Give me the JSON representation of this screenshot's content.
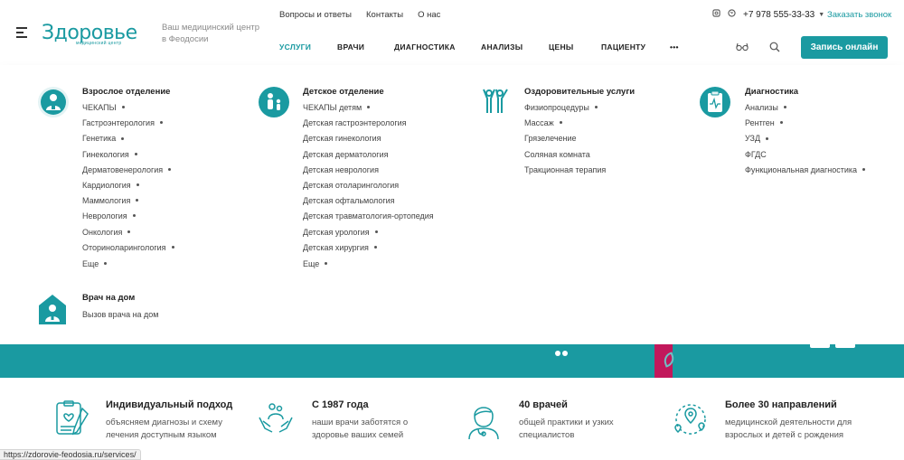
{
  "header": {
    "logo_text": "Здоровье",
    "logo_sub": "медицинский центр",
    "tagline": "Ваш медицинский центр в Феодосии",
    "top_links": [
      "Вопросы и ответы",
      "Контакты",
      "О нас"
    ],
    "phone": "+7 978 555-33-33",
    "callback": "Заказать звонок",
    "nav": [
      "УСЛУГИ",
      "ВРАЧИ",
      "ДИАГНОСТИКА",
      "АНАЛИЗЫ",
      "ЦЕНЫ",
      "ПАЦИЕНТУ",
      "•••"
    ],
    "cta": "Запись онлайн"
  },
  "menu": {
    "adult": {
      "title": "Взрослое отделение",
      "items": [
        "ЧЕКАПЫ",
        "Гастроэнтерология",
        "Генетика",
        "Гинекология",
        "Дерматовенерология",
        "Кардиология",
        "Маммология",
        "Неврология",
        "Онкология",
        "Оториноларингология",
        "Еще"
      ]
    },
    "child": {
      "title": "Детское отделение",
      "items": [
        "ЧЕКАПЫ детям",
        "Детская гастроэнтерология",
        "Детская гинекология",
        "Детская дерматология",
        "Детская неврология",
        "Детская отоларингология",
        "Детская офтальмология",
        "Детская травматология-ортопедия",
        "Детская урология",
        "Детская хирургия",
        "Еще"
      ]
    },
    "wellness": {
      "title": "Оздоровительные услуги",
      "items": [
        "Физиопроцедуры",
        "Массаж",
        "Грязелечение",
        "Соляная комната",
        "Тракционная терапия"
      ]
    },
    "diagnostics": {
      "title": "Диагностика",
      "items": [
        "Анализы",
        "Рентген",
        "УЗД",
        "ФГДС",
        "Функциональная диагностика"
      ]
    },
    "home": {
      "title": "Врач на дом",
      "items": [
        "Вызов врача на дом"
      ]
    }
  },
  "features": [
    {
      "title": "Индивидуальный подход",
      "text": "объясняем диагнозы и схему лечения доступным языком"
    },
    {
      "title": "С 1987 года",
      "text": "наши врачи заботятся о здоровье ваших семей"
    },
    {
      "title": "40 врачей",
      "text": "общей практики и узких специалистов"
    },
    {
      "title": "Более 30 направлений",
      "text": "медицинской деятельности для взрослых и детей с рождения"
    }
  ],
  "status_url": "https://zdorovie-feodosia.ru/services/",
  "colors": {
    "accent": "#1a9aa1",
    "stem": "#c2185b"
  }
}
